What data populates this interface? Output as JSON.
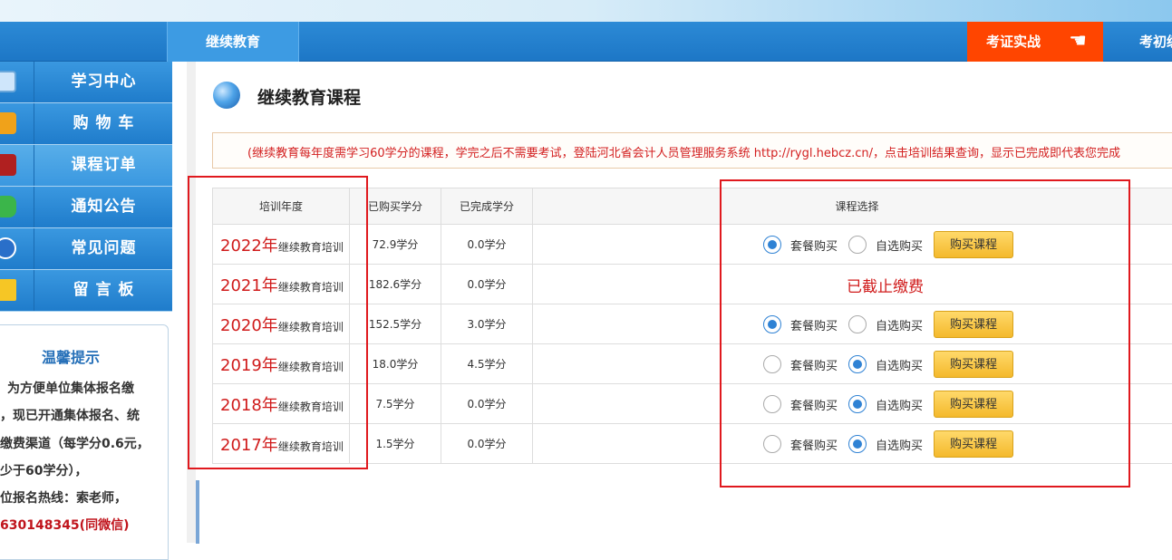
{
  "nav": {
    "active_tab": "继续教育",
    "exam_button": "考证实战",
    "right_tab": "考初级"
  },
  "sidebar": {
    "items": [
      {
        "label": "学习中心",
        "icon": "monitor-icon"
      },
      {
        "label": "购 物 车",
        "icon": "gift-icon"
      },
      {
        "label": "课程订单",
        "icon": "books-icon"
      },
      {
        "label": "通知公告",
        "icon": "chat-icon"
      },
      {
        "label": "常见问题",
        "icon": "question-icon"
      },
      {
        "label": "留 言 板",
        "icon": "envelope-icon"
      }
    ],
    "tips": {
      "title": "温馨提示",
      "lines": [
        "为方便单位集体报名缴",
        "，现已开通集体报名、统",
        "缴费渠道（每学分0.6元，",
        "少于60学分），",
        "位报名热线：索老师，",
        "630148345(同微信)"
      ]
    }
  },
  "main": {
    "title": "继续教育课程",
    "notice": "(继续教育每年度需学习60学分的课程，学完之后不需要考试，登陆河北省会计人员管理服务系统 http://rygl.hebcz.cn/，点击培训结果查询，显示已完成即代表您完成",
    "table": {
      "headers": [
        "培训年度",
        "已购买学分",
        "已完成学分",
        "课程选择"
      ],
      "year_suffix": "继续教育培训",
      "option_package": "套餐购买",
      "option_custom": "自选购买",
      "buy_label": "购买课程",
      "rows": [
        {
          "year": "2022年",
          "bought": "72.9学分",
          "done": "0.0学分",
          "selected": "package",
          "status": ""
        },
        {
          "year": "2021年",
          "bought": "182.6学分",
          "done": "0.0学分",
          "selected": "",
          "status": "已截止缴费"
        },
        {
          "year": "2020年",
          "bought": "152.5学分",
          "done": "3.0学分",
          "selected": "package",
          "status": ""
        },
        {
          "year": "2019年",
          "bought": "18.0学分",
          "done": "4.5学分",
          "selected": "custom",
          "status": ""
        },
        {
          "year": "2018年",
          "bought": "7.5学分",
          "done": "0.0学分",
          "selected": "custom",
          "status": ""
        },
        {
          "year": "2017年",
          "bought": "1.5学分",
          "done": "0.0学分",
          "selected": "custom",
          "status": ""
        }
      ]
    }
  },
  "colors": {
    "nav_blue": "#1d77c6",
    "exam_orange": "#ff4500",
    "annotation_red": "#e0191e",
    "year_red": "#d01b1b"
  }
}
